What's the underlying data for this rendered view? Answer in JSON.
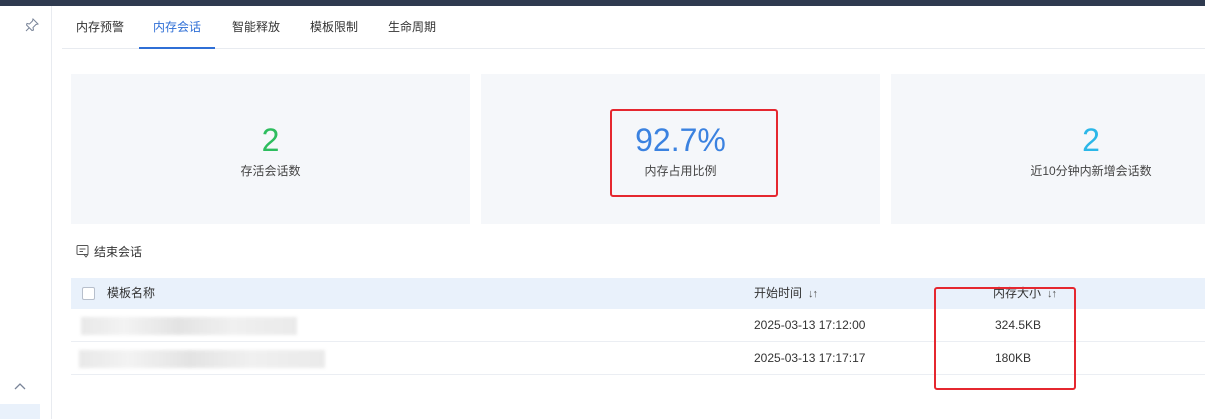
{
  "tabs": [
    {
      "label": "内存预警",
      "active": false
    },
    {
      "label": "内存会话",
      "active": true
    },
    {
      "label": "智能释放",
      "active": false
    },
    {
      "label": "模板限制",
      "active": false
    },
    {
      "label": "生命周期",
      "active": false
    }
  ],
  "stats": [
    {
      "value": "2",
      "label": "存活会话数",
      "color": "#2dbd5e"
    },
    {
      "value": "92.7%",
      "label": "内存占用比例",
      "color": "#3b82e0"
    },
    {
      "value": "2",
      "label": "近10分钟内新增会话数",
      "color": "#2bb7e8"
    }
  ],
  "toolbar": {
    "end_session_label": "结束会话"
  },
  "table": {
    "headers": {
      "name": "模板名称",
      "start_time": "开始时间",
      "memory": "内存大小"
    },
    "rows": [
      {
        "start_time": "2025-03-13 17:12:00",
        "memory": "324.5KB"
      },
      {
        "start_time": "2025-03-13 17:17:17",
        "memory": "180KB"
      }
    ]
  },
  "icons": {
    "pin": "pin-icon",
    "collapse": "chevron-up-icon",
    "end_session": "end-session-icon",
    "sort": "sort-icon"
  }
}
